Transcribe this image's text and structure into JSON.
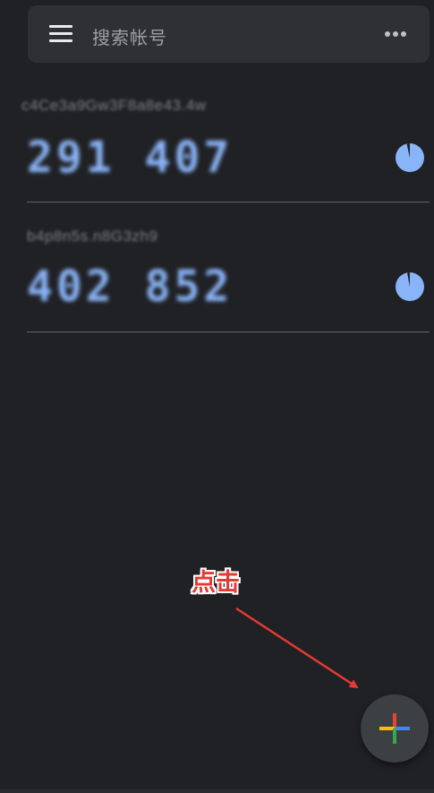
{
  "search": {
    "placeholder": "搜索帐号"
  },
  "accounts": [
    {
      "name": "c4Ce3a9Gw3F8a8e43.4w",
      "code": "291 407",
      "timer_color": "#8ab4f8"
    },
    {
      "name": "b4p8n5s.n8G3zh9",
      "code": "402 852",
      "timer_color": "#8ab4f8"
    }
  ],
  "annotation": {
    "label": "点击",
    "color": "#e53935"
  },
  "fab": {
    "icon": "add-icon",
    "colors": {
      "red": "#ea4335",
      "blue": "#4285f4",
      "yellow": "#fbbc04",
      "green": "#34a853"
    }
  },
  "theme": {
    "background": "#202124",
    "searchbar": "#2f3034",
    "accent": "#8ab4f8"
  }
}
